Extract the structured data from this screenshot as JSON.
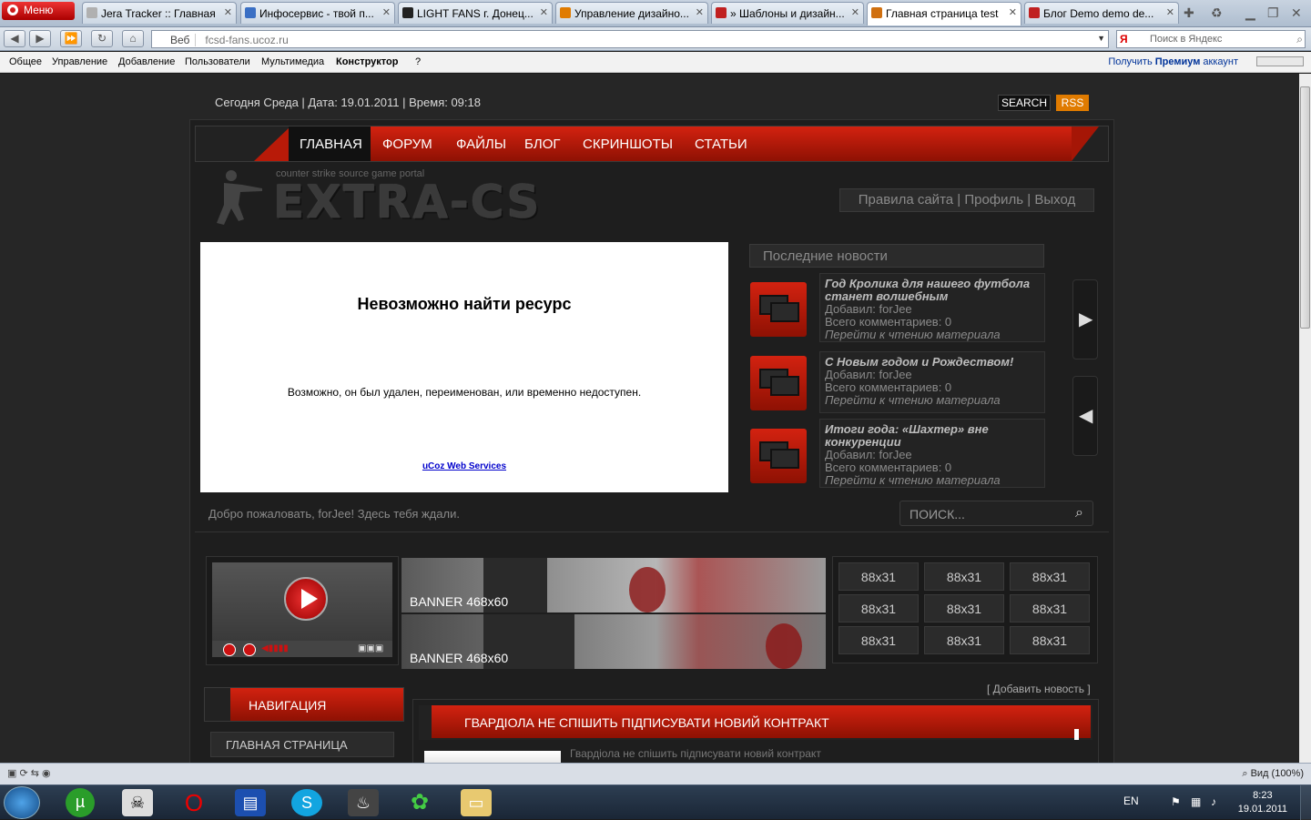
{
  "browser": {
    "menu_label": "Меню",
    "tabs": [
      {
        "title": "Jera Tracker :: Главная",
        "color": "#b0b0b0"
      },
      {
        "title": "Инфосервис - твой п...",
        "color": "#3a6fc4"
      },
      {
        "title": "LIGHT FANS г. Донец...",
        "color": "#222222"
      },
      {
        "title": "Управление дизайно...",
        "color": "#e07b00"
      },
      {
        "title": "» Шаблоны и дизайн...",
        "color": "#c02020"
      },
      {
        "title": "Главная страница test",
        "color": "#d07010"
      },
      {
        "title": "Блог Demo demo de...",
        "color": "#c02020"
      }
    ],
    "address_prefix": "Веб",
    "url": "fcsd-fans.ucoz.ru",
    "search_placeholder": "Поиск в Яндекс",
    "search_engine": "Я"
  },
  "ucoz_bar": {
    "items": [
      "Общее",
      "Управление",
      "Добавление",
      "Пользователи",
      "Мультимедиа",
      "Конструктор",
      "?"
    ],
    "premium_pre": "Получить ",
    "premium_bold": "Премиум",
    "premium_post": " аккаунт"
  },
  "site": {
    "top_info": "Сегодня Среда | Дата: 19.01.2011 | Время: 09:18",
    "search_btn": "SEARCH",
    "rss_btn": "RSS",
    "menu": [
      "ГЛАВНАЯ",
      "ФОРУМ",
      "ФАЙЛЫ",
      "БЛОГ",
      "СКРИНШОТЫ",
      "СТАТЬИ"
    ],
    "logo_subtitle": "counter strike source game portal",
    "logo_text": "EXTRA-CS",
    "user_links": "Правила сайта | Профиль | Выход",
    "error": {
      "title": "Невозможно найти ресурс",
      "message": "Возможно, он был удален, переименован, или временно недоступен.",
      "link": "uCoz Web Services"
    },
    "news_header": "Последние новости",
    "news": [
      {
        "title": "Год Кролика для нашего футбола станет волшебным",
        "author": "Добавил: forJee",
        "comments": "Всего комментариев: 0",
        "read": "Перейти к чтению материала"
      },
      {
        "title": "С Новым годом и Рождеством!",
        "author": "Добавил: forJee",
        "comments": "Всего комментариев: 0",
        "read": "Перейти к чтению материала"
      },
      {
        "title": "Итоги года: «Шахтер» вне конкуренции",
        "author": "Добавил: forJee",
        "comments": "Всего комментариев: 0",
        "read": "Перейти к чтению материала"
      }
    ],
    "welcome": "Добро пожаловать, forJee! Здесь тебя ждали.",
    "site_search_placeholder": "ПОИСК...",
    "banners": [
      "BANNER 468x60",
      "BANNER 468x60"
    ],
    "buttons_88": [
      "88x31",
      "88x31",
      "88x31",
      "88x31",
      "88x31",
      "88x31",
      "88x31",
      "88x31",
      "88x31"
    ],
    "add_news": "[ Добавить новость ]",
    "nav_header": "НАВИГАЦИЯ",
    "nav_items": [
      "ГЛАВНАЯ СТРАНИЦА"
    ],
    "article_title": "ГВАРДІОЛА НЕ СПІШИТЬ ПІДПИСУВАТИ НОВИЙ КОНТРАКТ",
    "article_sub": "Гвардіола не спішить підписувати новий контракт"
  },
  "statusbar": {
    "zoom": "Вид (100%)"
  },
  "taskbar": {
    "lang": "EN",
    "time": "8:23",
    "date": "19.01.2011"
  }
}
